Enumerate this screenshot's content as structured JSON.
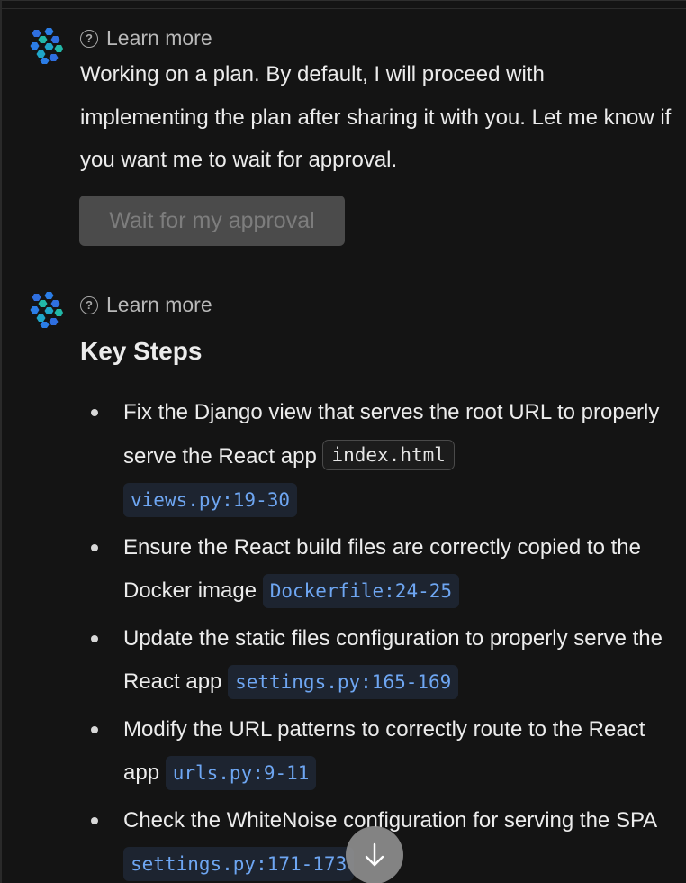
{
  "messages": [
    {
      "learn_more": "Learn more",
      "text": "Working on a plan. By default, I will proceed with implementing the plan after sharing it with you. Let me know if you want me to wait for approval.",
      "button_label": "Wait for my approval"
    },
    {
      "learn_more": "Learn more",
      "heading": "Key Steps",
      "steps": [
        {
          "text": "Fix the Django view that serves the root URL to properly serve the React app ",
          "code": "index.html",
          "ref": "views.py:19-30"
        },
        {
          "text": "Ensure the React build files are correctly copied to the Docker image ",
          "ref": "Dockerfile:24-25"
        },
        {
          "text": "Update the static files configuration to properly serve the React app ",
          "ref": "settings.py:165-169"
        },
        {
          "text": "Modify the URL patterns to correctly route to the React app ",
          "ref": "urls.py:9-11"
        },
        {
          "text": "Check the WhiteNoise configuration for serving the SPA ",
          "ref": "settings.py:171-173"
        }
      ]
    }
  ],
  "icons": {
    "avatar": "hexagon-cluster-logo-icon",
    "help": "question-circle-icon",
    "scroll": "arrow-down-icon"
  },
  "colors": {
    "background": "#141414",
    "link": "#6ea6f2",
    "button_bg": "#4b4b4b",
    "avatar_blue": "#2f6fe0",
    "avatar_teal": "#22b8a8"
  }
}
